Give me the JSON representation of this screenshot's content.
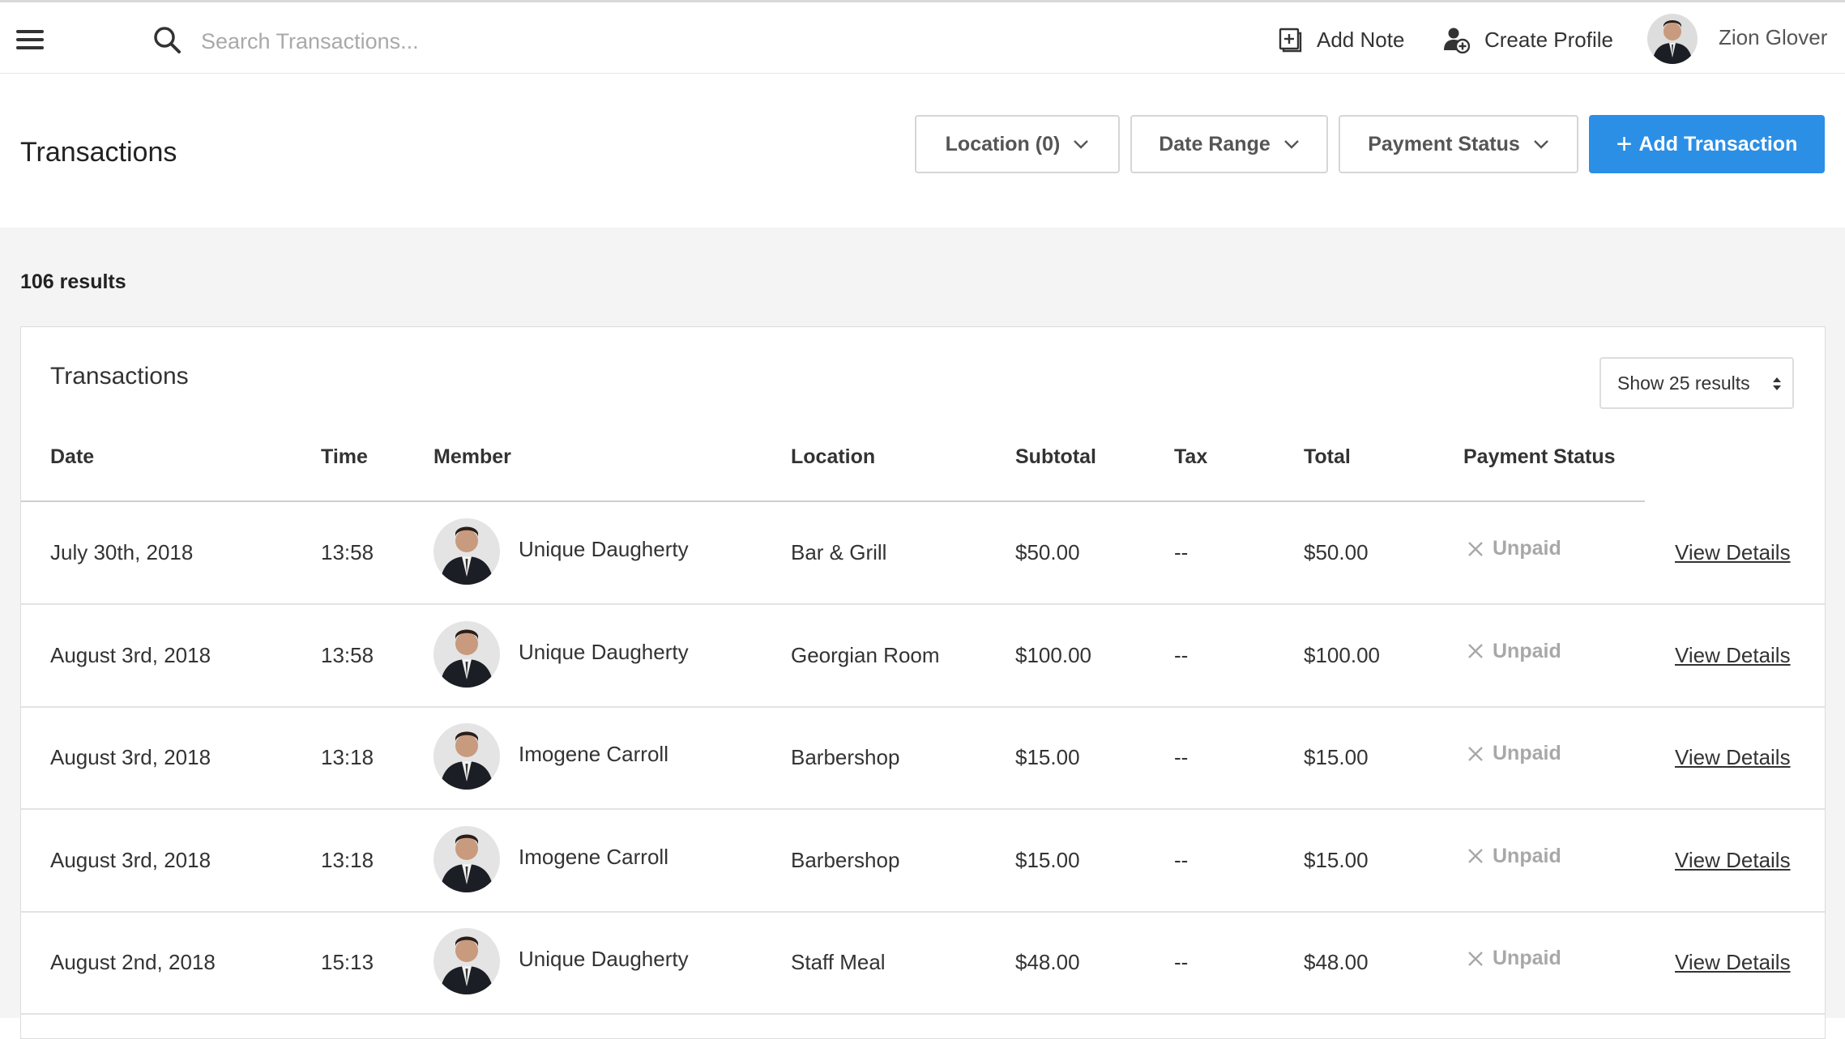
{
  "topbar": {
    "search_placeholder": "Search Transactions...",
    "add_note_label": "Add Note",
    "create_profile_label": "Create Profile",
    "user_name": "Zion Glover"
  },
  "header": {
    "title": "Transactions",
    "filters": {
      "location": "Location (0)",
      "date_range": "Date Range",
      "payment_status": "Payment Status"
    },
    "add_transaction_label": "Add Transaction"
  },
  "results": {
    "count_label": "106 results"
  },
  "table": {
    "title": "Transactions",
    "page_size_label": "Show 25 results",
    "columns": {
      "date": "Date",
      "time": "Time",
      "member": "Member",
      "location": "Location",
      "subtotal": "Subtotal",
      "tax": "Tax",
      "total": "Total",
      "payment_status": "Payment Status"
    },
    "rows": [
      {
        "date": "July 30th, 2018",
        "time": "13:58",
        "member": "Unique Daugherty",
        "location": "Bar & Grill",
        "subtotal": "$50.00",
        "tax": "--",
        "total": "$50.00",
        "status": "Unpaid",
        "action": "View Details"
      },
      {
        "date": "August 3rd, 2018",
        "time": "13:58",
        "member": "Unique Daugherty",
        "location": "Georgian Room",
        "subtotal": "$100.00",
        "tax": "--",
        "total": "$100.00",
        "status": "Unpaid",
        "action": "View Details"
      },
      {
        "date": "August 3rd, 2018",
        "time": "13:18",
        "member": "Imogene Carroll",
        "location": "Barbershop",
        "subtotal": "$15.00",
        "tax": "--",
        "total": "$15.00",
        "status": "Unpaid",
        "action": "View Details"
      },
      {
        "date": "August 3rd, 2018",
        "time": "13:18",
        "member": "Imogene Carroll",
        "location": "Barbershop",
        "subtotal": "$15.00",
        "tax": "--",
        "total": "$15.00",
        "status": "Unpaid",
        "action": "View Details"
      },
      {
        "date": "August 2nd, 2018",
        "time": "15:13",
        "member": "Unique Daugherty",
        "location": "Staff Meal",
        "subtotal": "$48.00",
        "tax": "--",
        "total": "$48.00",
        "status": "Unpaid",
        "action": "View Details"
      }
    ]
  },
  "colors": {
    "accent": "#2b8fe6",
    "status_muted": "#a8a8a8"
  },
  "icons": [
    "menu-icon",
    "search-icon",
    "note-icon",
    "add-user-icon",
    "chevron-down-icon",
    "plus-icon",
    "close-icon",
    "sort-updown-icon"
  ]
}
